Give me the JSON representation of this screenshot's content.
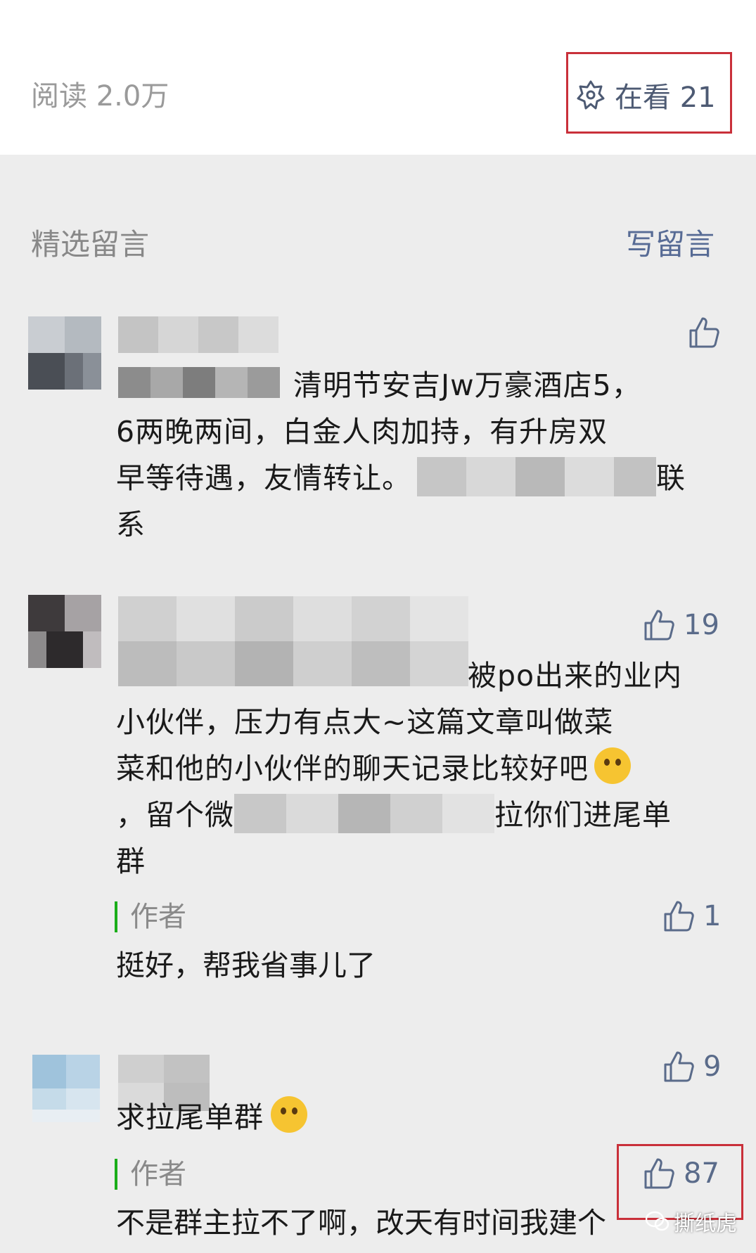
{
  "stats": {
    "read_label": "阅读 2.0万",
    "looking_label": "在看 21"
  },
  "section": {
    "title": "精选留言",
    "write_label": "写留言"
  },
  "comments": [
    {
      "text_line1": "清明节安吉Jw万豪酒店5，",
      "text_line2": "6两晚两间，白金人肉加持，有升房双",
      "text_line3a": "早等待遇，友情转让。",
      "text_line3b": "联",
      "text_line4": "系",
      "likes": ""
    },
    {
      "text_line1": "被po出来的业内",
      "text_line2": "小伙伴，压力有点大~这篇文章叫做菜",
      "text_line3": "菜和他的小伙伴的聊天记录比较好吧",
      "text_line4a": "，留个微",
      "text_line4b": "拉你们进尾单",
      "text_line5": "群",
      "likes": "19",
      "reply": {
        "author": "作者",
        "text": "挺好，帮我省事儿了",
        "likes": "1"
      }
    },
    {
      "text_line1": "求拉尾单群",
      "likes": "9",
      "reply": {
        "author": "作者",
        "text": "不是群主拉不了啊，改天有时间我建个",
        "likes": "87"
      }
    }
  ],
  "watermark": "撕纸虎"
}
